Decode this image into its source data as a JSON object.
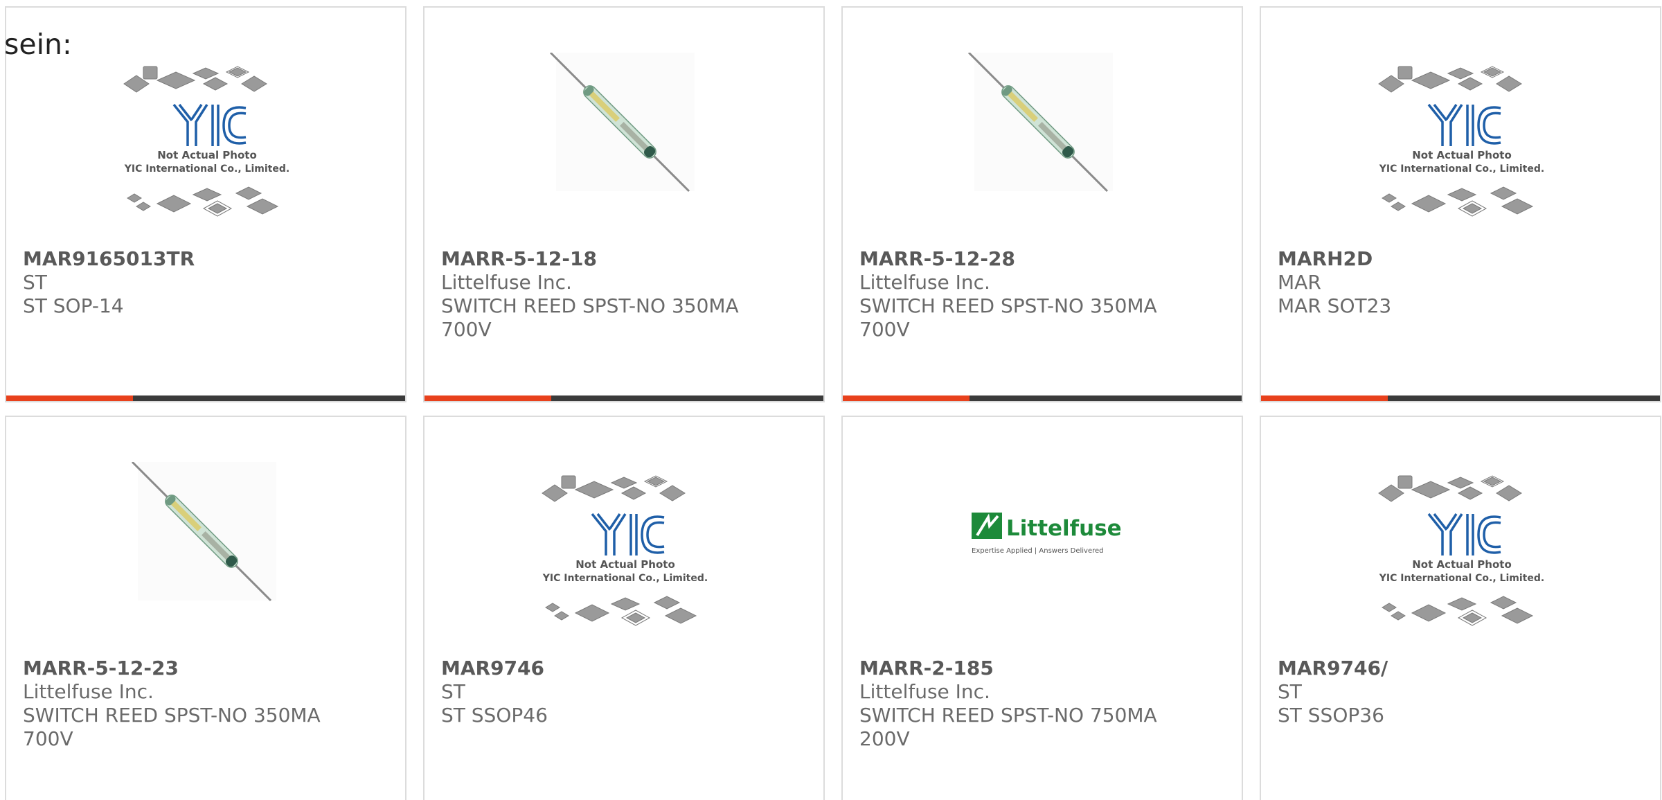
{
  "intro_text": "sein:",
  "colors": {
    "accent_bar": "#e8411c",
    "bar_track": "#3b3b3b",
    "text": "#6a6a6a",
    "title": "#595959",
    "yic_blue": "#1f5fa8",
    "littelfuse_green": "#1d8a3a"
  },
  "placeholder_photo": {
    "line1": "Not Actual Photo",
    "line2": "YIC International Co., Limited.",
    "logo_text": "YIC"
  },
  "littelfuse_logo": {
    "wordmark": "Littelfuse",
    "tagline": "Expertise Applied | Answers Delivered"
  },
  "products": [
    {
      "part_number": "MAR9165013TR",
      "manufacturer": "ST",
      "description": "ST SOP-14",
      "image": "yic-placeholder"
    },
    {
      "part_number": "MARR-5-12-18",
      "manufacturer": "Littelfuse Inc.",
      "description": "SWITCH REED SPST-NO 350MA 700V",
      "image": "reed-switch"
    },
    {
      "part_number": "MARR-5-12-28",
      "manufacturer": "Littelfuse Inc.",
      "description": "SWITCH REED SPST-NO 350MA 700V",
      "image": "reed-switch"
    },
    {
      "part_number": "MARH2D",
      "manufacturer": "MAR",
      "description": "MAR SOT23",
      "image": "yic-placeholder"
    },
    {
      "part_number": "MARR-5-12-23",
      "manufacturer": "Littelfuse Inc.",
      "description": "SWITCH REED SPST-NO 350MA 700V",
      "image": "reed-switch"
    },
    {
      "part_number": "MAR9746",
      "manufacturer": "ST",
      "description": "ST SSOP46",
      "image": "yic-placeholder"
    },
    {
      "part_number": "MARR-2-185",
      "manufacturer": "Littelfuse Inc.",
      "description": "SWITCH REED SPST-NO 750MA 200V",
      "image": "littelfuse-logo"
    },
    {
      "part_number": "MAR9746/",
      "manufacturer": "ST",
      "description": "ST SSOP36",
      "image": "yic-placeholder"
    }
  ]
}
